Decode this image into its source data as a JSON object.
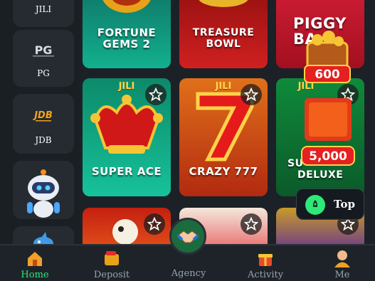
{
  "sidebar": {
    "providers": [
      {
        "label": "JILI"
      },
      {
        "label": "PG",
        "logo": "PG"
      },
      {
        "label": "JDB",
        "logo": "JDB"
      }
    ]
  },
  "games": [
    {
      "title_line1": "FORTUNE",
      "title_line2": "GEMS 2"
    },
    {
      "title_line1": "TREASURE",
      "title_line2": "BOWL"
    },
    {
      "title_line1": "PIGGY",
      "title_line2": "BA"
    },
    {
      "title_line1": "SUPER ACE",
      "tag": "JILI"
    },
    {
      "title_line1": "CRAZY 777",
      "tag": "JILI"
    },
    {
      "title_line1": "SU",
      "title_line2": "DELUXE",
      "tag": "JILI"
    }
  ],
  "overlay": {
    "chest_amount": "600",
    "gift_amount": "5,000"
  },
  "top_button": {
    "label": "Top"
  },
  "bottom_nav": [
    {
      "label": "Home",
      "icon": "home-icon",
      "active": true
    },
    {
      "label": "Deposit",
      "icon": "wallet-icon"
    },
    {
      "label": "Agency",
      "icon": "handshake-icon"
    },
    {
      "label": "Activity",
      "icon": "gift-icon"
    },
    {
      "label": "Me",
      "icon": "user-icon"
    }
  ],
  "colors": {
    "accent": "#2ee87a",
    "background": "#1c2127"
  }
}
